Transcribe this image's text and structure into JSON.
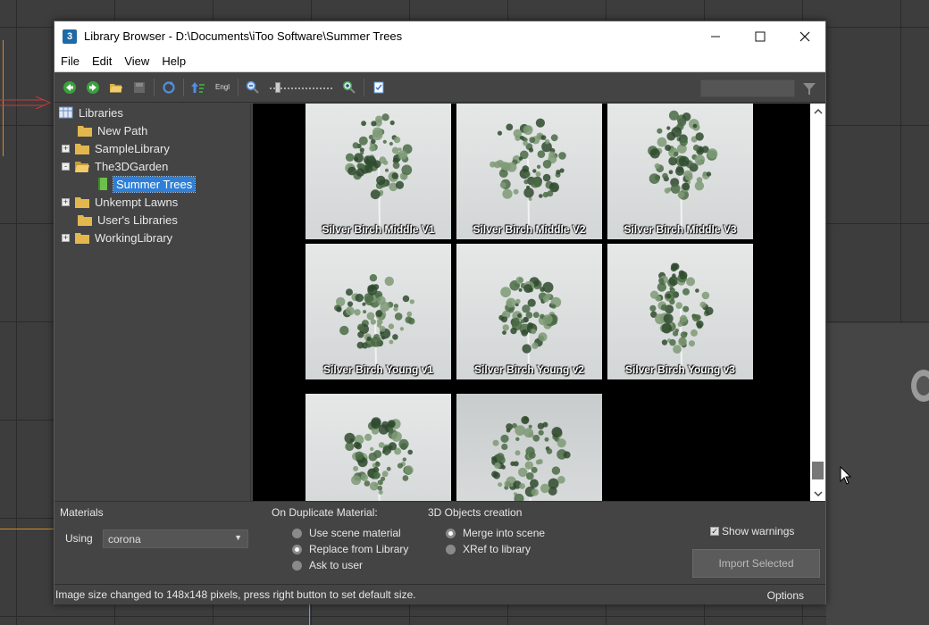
{
  "window": {
    "title": "Library Browser - D:\\Documents\\iToo Software\\Summer Trees",
    "app_icon_glyph": "3"
  },
  "menu": [
    "File",
    "Edit",
    "View",
    "Help"
  ],
  "toolbar": {
    "language_label": "Engl",
    "zoom_level": 0.15,
    "search_value": ""
  },
  "tree": {
    "root": "Libraries",
    "items": [
      {
        "label": "New Path",
        "expander": ""
      },
      {
        "label": "SampleLibrary",
        "expander": "+"
      },
      {
        "label": "The3DGarden",
        "expander": "-"
      },
      {
        "label": "Summer Trees",
        "expander": "",
        "selected": true
      },
      {
        "label": "Unkempt Lawns",
        "expander": "+"
      },
      {
        "label": "User's Libraries",
        "expander": ""
      },
      {
        "label": "WorkingLibrary",
        "expander": "+"
      }
    ]
  },
  "thumbnails": [
    {
      "label": "Silver Birch Middle V1"
    },
    {
      "label": "Silver Birch Middle V2"
    },
    {
      "label": "Silver Birch Middle V3"
    },
    {
      "label": "Silver Birch Young v1"
    },
    {
      "label": "Silver Birch Young v2"
    },
    {
      "label": "Silver Birch Young v3"
    },
    {
      "label": ""
    },
    {
      "label": ""
    }
  ],
  "bottom": {
    "materials_title": "Materials",
    "using_label": "Using",
    "using_value": "corona",
    "duplicate_title": "On Duplicate Material:",
    "duplicate_options": [
      {
        "label": "Use scene material",
        "selected": false
      },
      {
        "label": "Replace from Library",
        "selected": true
      },
      {
        "label": "Ask to user",
        "selected": false
      }
    ],
    "objects_title": "3D Objects creation",
    "objects_options": [
      {
        "label": "Merge into scene",
        "selected": true
      },
      {
        "label": "XRef to library",
        "selected": false
      }
    ],
    "show_warnings_label": "Show warnings",
    "show_warnings_checked": true,
    "import_button": "Import Selected"
  },
  "status": {
    "text": "Image size changed to 148x148 pixels, press right button to set default size.",
    "options_label": "Options"
  },
  "colors": {
    "selection": "#2f7fd6",
    "panel": "#444444",
    "foliage": "#4a6b45"
  }
}
